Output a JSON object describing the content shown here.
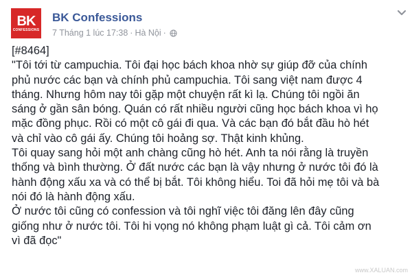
{
  "post": {
    "logo": {
      "mark": "BK",
      "sub": "CONFESSIONS"
    },
    "page_name": "BK Confessions",
    "timestamp": "7 Tháng 1 lúc 17:38",
    "separator": "·",
    "location": "Hà Nội",
    "privacy_icon": "globe-icon",
    "menu_icon": "chevron-down-icon",
    "lines": [
      "[#8464]",
      "\"Tôi tới từ campuchia. Tôi đại học bách khoa nhờ sự giúp đỡ của chính",
      "phủ nước các bạn và chính phủ campuchia. Tôi sang việt nam được 4",
      "tháng. Nhưng hôm nay tôi gặp một chuyện rất kì lạ. Chúng tôi ngồi ăn",
      "sáng ở gần sân bóng. Quán có rất nhiều người cũng học bách khoa vì họ",
      "mặc đồng phục. Rồi có một cô gái đi qua. Và các bạn đó bắt đầu hò hét",
      "và chỉ vào cô gái ấy. Chúng tôi hoảng sợ. Thật kinh khủng.",
      "Tôi quay sang hỏi một anh chàng cũng hò hét. Anh ta nói rằng là truyền",
      "thống và bình thường. Ở đất nước các bạn là vậy nhưng ở nước tôi đó là",
      "hành động xấu xa và có thể bị bắt. Tôi không hiểu. Toi đã hỏi mẹ tôi và bà",
      "nói đó là hành động xấu.",
      "Ở nước tôi cũng có confession và tôi nghĩ việc tôi đăng lên đây cũng",
      "giống như ở nước tôi. Tôi hi vọng nó không phạm luật gì cả. Tôi cảm ơn",
      "vì đã đọc\""
    ]
  },
  "watermark": "www.XALUAN.com",
  "colors": {
    "logo_bg": "#d72828",
    "link": "#3b5998",
    "meta": "#90949c",
    "text": "#1d2129"
  }
}
